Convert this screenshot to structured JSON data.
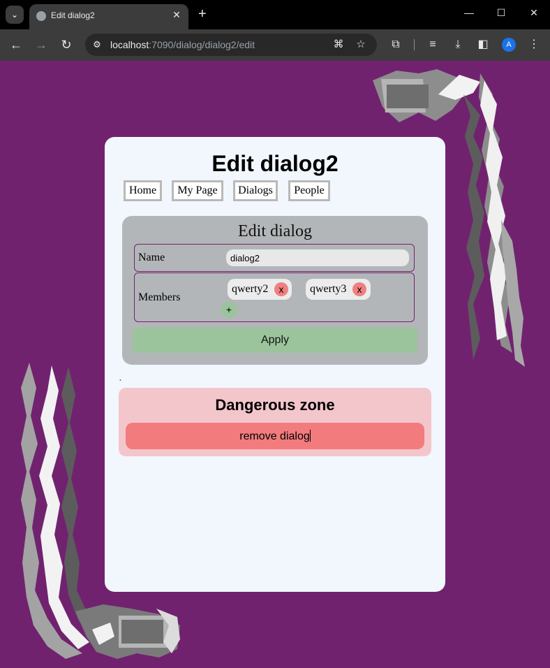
{
  "browser": {
    "tab_title": "Edit dialog2",
    "url_host": "localhost",
    "url_path": ":7090/dialog/dialog2/edit",
    "profile_initial": "A"
  },
  "page": {
    "title": "Edit dialog2",
    "nav": [
      "Home",
      "My Page",
      "Dialogs",
      "People"
    ]
  },
  "form": {
    "title": "Edit dialog",
    "name_label": "Name",
    "name_value": "dialog2",
    "members_label": "Members",
    "members": [
      "qwerty2",
      "qwerty3"
    ],
    "remove_member_label": "x",
    "add_member_label": "+",
    "apply_label": "Apply"
  },
  "danger": {
    "note": "˳",
    "title": "Dangerous zone",
    "remove_label": "remove dialog"
  },
  "colors": {
    "background": "#71226f",
    "card": "#f1f7fd",
    "form_box": "#b3b6b8",
    "apply": "#9bc49c",
    "danger_zone": "#f3c6cc",
    "remove": "#f27b7d"
  }
}
